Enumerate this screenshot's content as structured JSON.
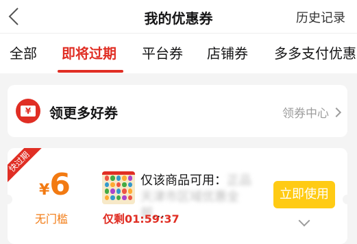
{
  "nav": {
    "title": "我的优惠券",
    "history_label": "历史记录"
  },
  "tabs": [
    {
      "label": "全部"
    },
    {
      "label": "即将过期",
      "active": true
    },
    {
      "label": "平台券"
    },
    {
      "label": "店铺券"
    },
    {
      "label": "多多支付优惠"
    }
  ],
  "get_more": {
    "icon_glyph": "¥",
    "title": "领更多好券",
    "center_link": "领券中心"
  },
  "coupon": {
    "ribbon": "快过期",
    "currency": "¥",
    "amount": "6",
    "threshold": "无门槛",
    "product_line1_visible": "仅该商品可用：",
    "product_line1_blur": "正品",
    "product_line2_blur": "天津市区域优惠全部",
    "product_line2_tail": "...",
    "time_remaining": "仅剩01:59:37",
    "use_button": "立即使用"
  },
  "colors": {
    "accent_red": "#e02e24",
    "amount_orange": "#f27a12",
    "button_yellow": "#ffcb14"
  }
}
